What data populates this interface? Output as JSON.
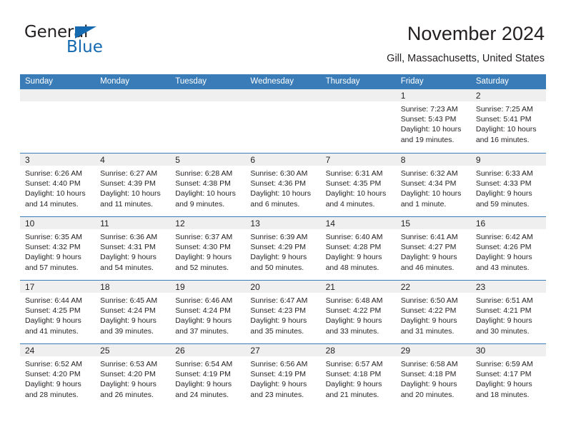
{
  "brand": {
    "word_one": "General",
    "word_two": "Blue",
    "triangle_color": "#1569b1"
  },
  "header": {
    "title": "November 2024",
    "subtitle": "Gill, Massachusetts, United States"
  },
  "theme": {
    "header_blue": "#3a7cb8",
    "daynum_band": "#efefef",
    "text": "#231f20"
  },
  "weekdays": [
    "Sunday",
    "Monday",
    "Tuesday",
    "Wednesday",
    "Thursday",
    "Friday",
    "Saturday"
  ],
  "weeks": [
    [
      {
        "empty": true
      },
      {
        "empty": true
      },
      {
        "empty": true
      },
      {
        "empty": true
      },
      {
        "empty": true
      },
      {
        "day": "1",
        "sunrise": "Sunrise: 7:23 AM",
        "sunset": "Sunset: 5:43 PM",
        "daylight_1": "Daylight: 10 hours",
        "daylight_2": "and 19 minutes."
      },
      {
        "day": "2",
        "sunrise": "Sunrise: 7:25 AM",
        "sunset": "Sunset: 5:41 PM",
        "daylight_1": "Daylight: 10 hours",
        "daylight_2": "and 16 minutes."
      }
    ],
    [
      {
        "day": "3",
        "sunrise": "Sunrise: 6:26 AM",
        "sunset": "Sunset: 4:40 PM",
        "daylight_1": "Daylight: 10 hours",
        "daylight_2": "and 14 minutes."
      },
      {
        "day": "4",
        "sunrise": "Sunrise: 6:27 AM",
        "sunset": "Sunset: 4:39 PM",
        "daylight_1": "Daylight: 10 hours",
        "daylight_2": "and 11 minutes."
      },
      {
        "day": "5",
        "sunrise": "Sunrise: 6:28 AM",
        "sunset": "Sunset: 4:38 PM",
        "daylight_1": "Daylight: 10 hours",
        "daylight_2": "and 9 minutes."
      },
      {
        "day": "6",
        "sunrise": "Sunrise: 6:30 AM",
        "sunset": "Sunset: 4:36 PM",
        "daylight_1": "Daylight: 10 hours",
        "daylight_2": "and 6 minutes."
      },
      {
        "day": "7",
        "sunrise": "Sunrise: 6:31 AM",
        "sunset": "Sunset: 4:35 PM",
        "daylight_1": "Daylight: 10 hours",
        "daylight_2": "and 4 minutes."
      },
      {
        "day": "8",
        "sunrise": "Sunrise: 6:32 AM",
        "sunset": "Sunset: 4:34 PM",
        "daylight_1": "Daylight: 10 hours",
        "daylight_2": "and 1 minute."
      },
      {
        "day": "9",
        "sunrise": "Sunrise: 6:33 AM",
        "sunset": "Sunset: 4:33 PM",
        "daylight_1": "Daylight: 9 hours",
        "daylight_2": "and 59 minutes."
      }
    ],
    [
      {
        "day": "10",
        "sunrise": "Sunrise: 6:35 AM",
        "sunset": "Sunset: 4:32 PM",
        "daylight_1": "Daylight: 9 hours",
        "daylight_2": "and 57 minutes."
      },
      {
        "day": "11",
        "sunrise": "Sunrise: 6:36 AM",
        "sunset": "Sunset: 4:31 PM",
        "daylight_1": "Daylight: 9 hours",
        "daylight_2": "and 54 minutes."
      },
      {
        "day": "12",
        "sunrise": "Sunrise: 6:37 AM",
        "sunset": "Sunset: 4:30 PM",
        "daylight_1": "Daylight: 9 hours",
        "daylight_2": "and 52 minutes."
      },
      {
        "day": "13",
        "sunrise": "Sunrise: 6:39 AM",
        "sunset": "Sunset: 4:29 PM",
        "daylight_1": "Daylight: 9 hours",
        "daylight_2": "and 50 minutes."
      },
      {
        "day": "14",
        "sunrise": "Sunrise: 6:40 AM",
        "sunset": "Sunset: 4:28 PM",
        "daylight_1": "Daylight: 9 hours",
        "daylight_2": "and 48 minutes."
      },
      {
        "day": "15",
        "sunrise": "Sunrise: 6:41 AM",
        "sunset": "Sunset: 4:27 PM",
        "daylight_1": "Daylight: 9 hours",
        "daylight_2": "and 46 minutes."
      },
      {
        "day": "16",
        "sunrise": "Sunrise: 6:42 AM",
        "sunset": "Sunset: 4:26 PM",
        "daylight_1": "Daylight: 9 hours",
        "daylight_2": "and 43 minutes."
      }
    ],
    [
      {
        "day": "17",
        "sunrise": "Sunrise: 6:44 AM",
        "sunset": "Sunset: 4:25 PM",
        "daylight_1": "Daylight: 9 hours",
        "daylight_2": "and 41 minutes."
      },
      {
        "day": "18",
        "sunrise": "Sunrise: 6:45 AM",
        "sunset": "Sunset: 4:24 PM",
        "daylight_1": "Daylight: 9 hours",
        "daylight_2": "and 39 minutes."
      },
      {
        "day": "19",
        "sunrise": "Sunrise: 6:46 AM",
        "sunset": "Sunset: 4:24 PM",
        "daylight_1": "Daylight: 9 hours",
        "daylight_2": "and 37 minutes."
      },
      {
        "day": "20",
        "sunrise": "Sunrise: 6:47 AM",
        "sunset": "Sunset: 4:23 PM",
        "daylight_1": "Daylight: 9 hours",
        "daylight_2": "and 35 minutes."
      },
      {
        "day": "21",
        "sunrise": "Sunrise: 6:48 AM",
        "sunset": "Sunset: 4:22 PM",
        "daylight_1": "Daylight: 9 hours",
        "daylight_2": "and 33 minutes."
      },
      {
        "day": "22",
        "sunrise": "Sunrise: 6:50 AM",
        "sunset": "Sunset: 4:22 PM",
        "daylight_1": "Daylight: 9 hours",
        "daylight_2": "and 31 minutes."
      },
      {
        "day": "23",
        "sunrise": "Sunrise: 6:51 AM",
        "sunset": "Sunset: 4:21 PM",
        "daylight_1": "Daylight: 9 hours",
        "daylight_2": "and 30 minutes."
      }
    ],
    [
      {
        "day": "24",
        "sunrise": "Sunrise: 6:52 AM",
        "sunset": "Sunset: 4:20 PM",
        "daylight_1": "Daylight: 9 hours",
        "daylight_2": "and 28 minutes."
      },
      {
        "day": "25",
        "sunrise": "Sunrise: 6:53 AM",
        "sunset": "Sunset: 4:20 PM",
        "daylight_1": "Daylight: 9 hours",
        "daylight_2": "and 26 minutes."
      },
      {
        "day": "26",
        "sunrise": "Sunrise: 6:54 AM",
        "sunset": "Sunset: 4:19 PM",
        "daylight_1": "Daylight: 9 hours",
        "daylight_2": "and 24 minutes."
      },
      {
        "day": "27",
        "sunrise": "Sunrise: 6:56 AM",
        "sunset": "Sunset: 4:19 PM",
        "daylight_1": "Daylight: 9 hours",
        "daylight_2": "and 23 minutes."
      },
      {
        "day": "28",
        "sunrise": "Sunrise: 6:57 AM",
        "sunset": "Sunset: 4:18 PM",
        "daylight_1": "Daylight: 9 hours",
        "daylight_2": "and 21 minutes."
      },
      {
        "day": "29",
        "sunrise": "Sunrise: 6:58 AM",
        "sunset": "Sunset: 4:18 PM",
        "daylight_1": "Daylight: 9 hours",
        "daylight_2": "and 20 minutes."
      },
      {
        "day": "30",
        "sunrise": "Sunrise: 6:59 AM",
        "sunset": "Sunset: 4:17 PM",
        "daylight_1": "Daylight: 9 hours",
        "daylight_2": "and 18 minutes."
      }
    ]
  ]
}
